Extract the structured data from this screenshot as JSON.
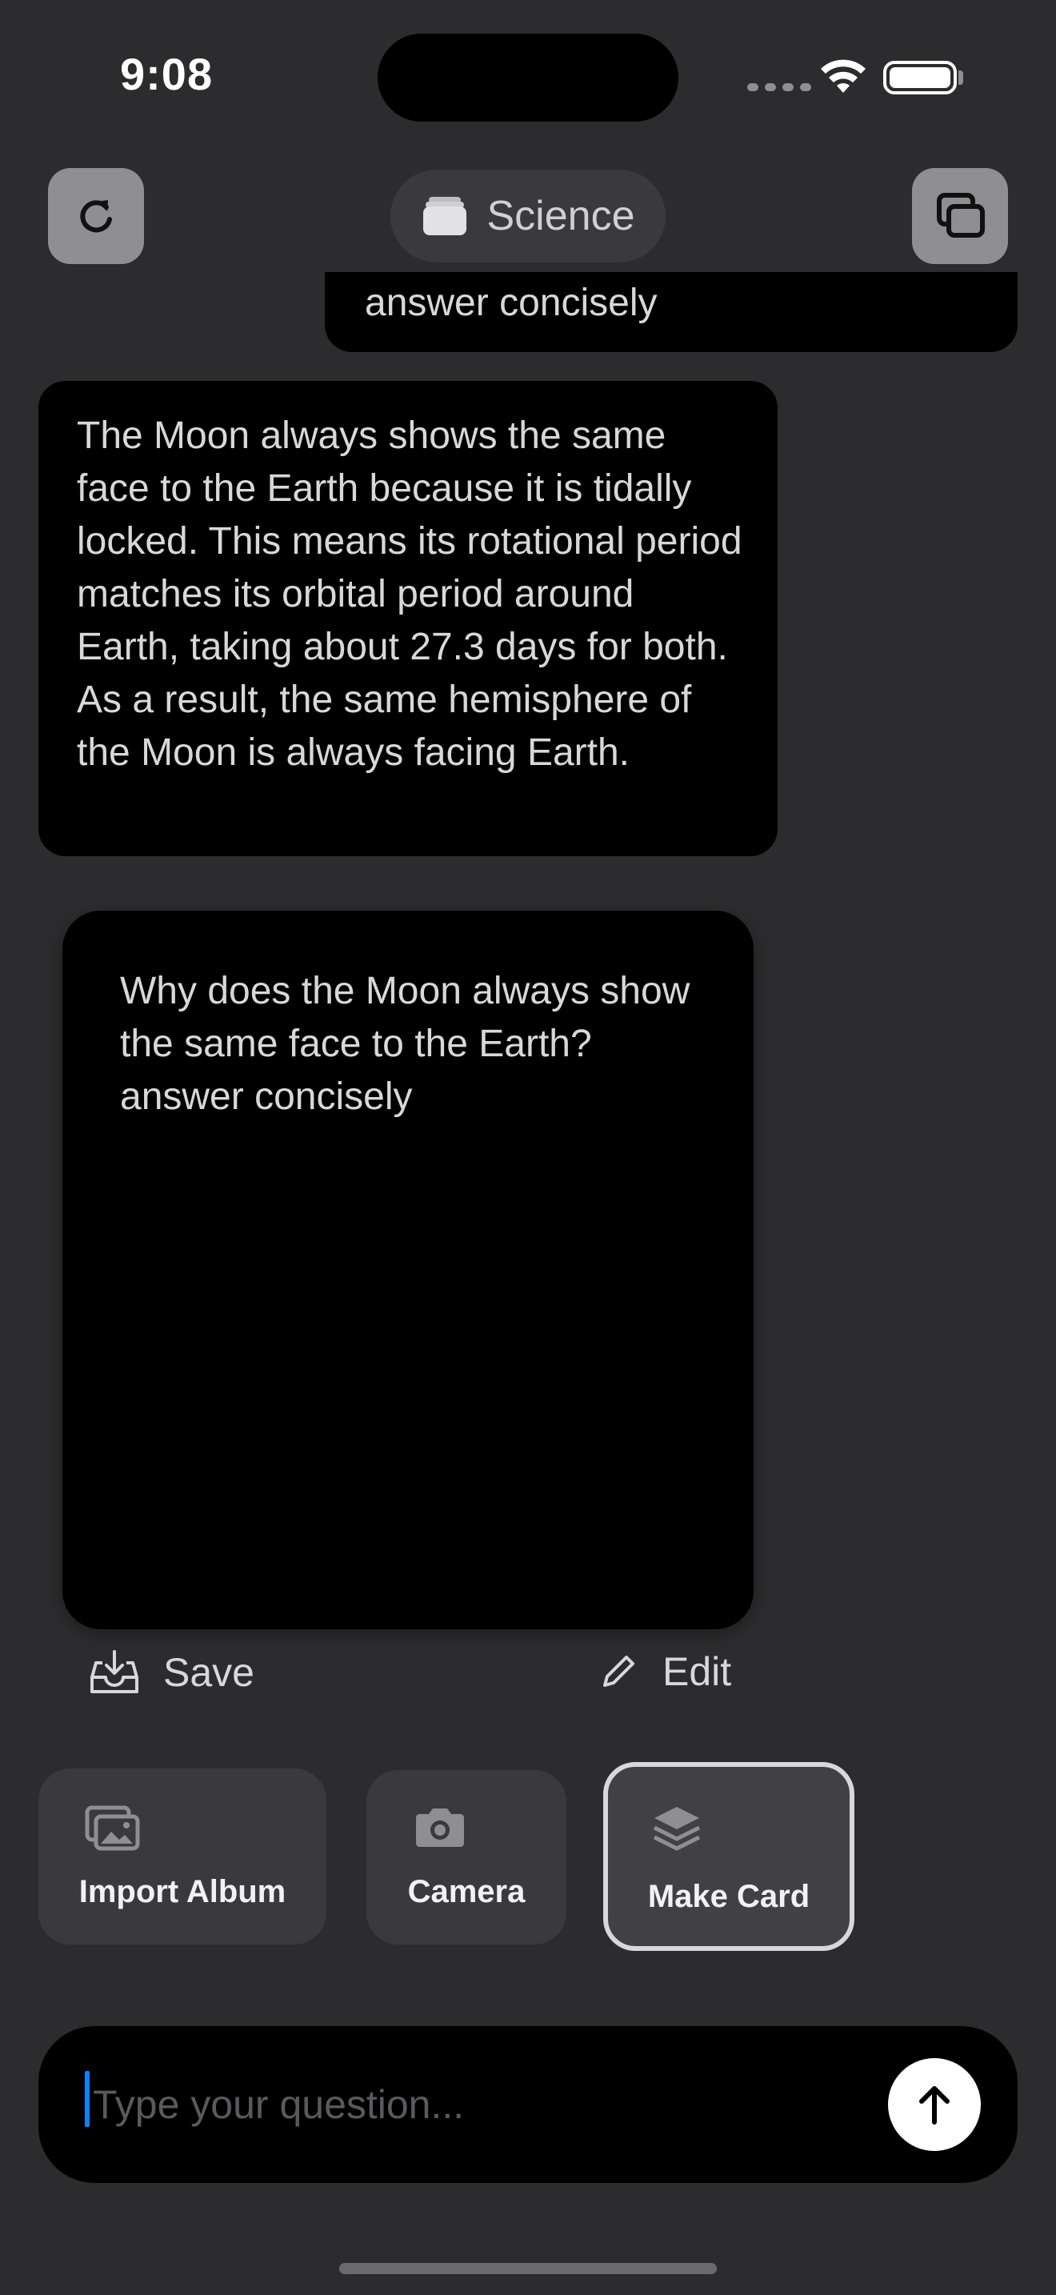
{
  "status_bar": {
    "time": "9:08"
  },
  "header": {
    "folder_label": "Science",
    "refresh_icon": "refresh-icon",
    "tabs_icon": "windows-icon",
    "folder_icon": "folder-stack-icon"
  },
  "chat": {
    "user_message_tail": "answer concisely",
    "assistant_answer": "The Moon always shows the same face to the Earth because it is tidally locked. This means its rotational period matches its orbital period around Earth, taking about 27.3 days for both. As a result, the same hemisphere of the Moon is always facing Earth."
  },
  "card": {
    "text": "Why does the Moon always show the same face to the Earth?\nanswer concisely",
    "save_label": "Save",
    "edit_label": "Edit"
  },
  "quick_actions": [
    {
      "label": "Import Album",
      "icon": "photo-album-icon"
    },
    {
      "label": "Camera",
      "icon": "camera-icon"
    },
    {
      "label": "Make Card",
      "icon": "layers-icon",
      "selected": true
    }
  ],
  "composer": {
    "placeholder": "Type your question...",
    "value": ""
  },
  "colors": {
    "background": "#2c2c2e",
    "bubble": "#000000",
    "tile": "#3a3a3c",
    "caret": "#0a84ff"
  }
}
